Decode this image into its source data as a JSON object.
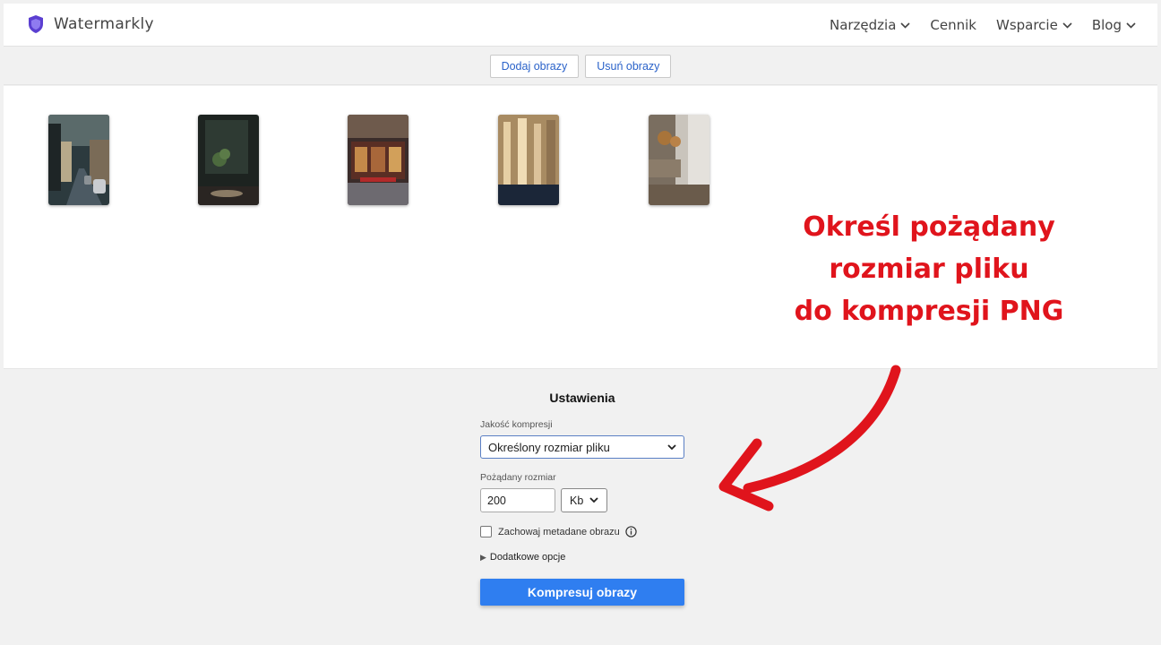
{
  "header": {
    "brand": "Watermarkly",
    "nav": [
      {
        "label": "Narzędzia",
        "dropdown": true
      },
      {
        "label": "Cennik",
        "dropdown": false
      },
      {
        "label": "Wsparcie",
        "dropdown": true
      },
      {
        "label": "Blog",
        "dropdown": true
      }
    ]
  },
  "toolbar": {
    "add_label": "Dodaj obrazy",
    "remove_label": "Usuń obrazy"
  },
  "gallery": {
    "image_count": 5
  },
  "annotation": {
    "line1": "Określ pożądany",
    "line2": "rozmiar pliku",
    "line3": "do kompresji PNG",
    "color": "#e0141c"
  },
  "settings": {
    "title": "Ustawienia",
    "quality_label": "Jakość kompresji",
    "quality_value": "Określony rozmiar pliku",
    "size_label": "Pożądany rozmiar",
    "size_value": "200",
    "unit_value": "Kb",
    "metadata_label": "Zachowaj metadane obrazu",
    "metadata_checked": false,
    "more_options_label": "Dodatkowe opcje",
    "submit_label": "Kompresuj obrazy"
  },
  "colors": {
    "accent": "#2f7ef0",
    "link": "#2a62c9",
    "logo": "#5b3fd1"
  }
}
